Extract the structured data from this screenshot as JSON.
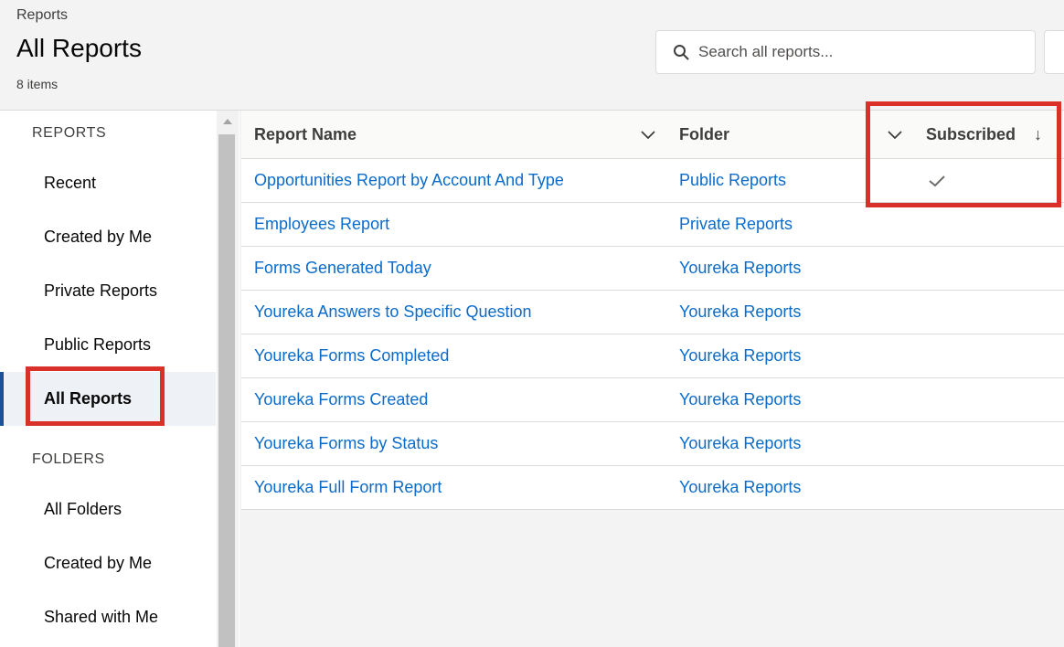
{
  "header": {
    "breadcrumb": "Reports",
    "title": "All Reports",
    "item_count": "8 items",
    "search_placeholder": "Search all reports..."
  },
  "sidebar": {
    "reports_heading": "REPORTS",
    "report_items": [
      {
        "label": "Recent"
      },
      {
        "label": "Created by Me"
      },
      {
        "label": "Private Reports"
      },
      {
        "label": "Public Reports"
      },
      {
        "label": "All Reports",
        "active": true
      }
    ],
    "folders_heading": "FOLDERS",
    "folder_items": [
      {
        "label": "All Folders"
      },
      {
        "label": "Created by Me"
      },
      {
        "label": "Shared with Me"
      }
    ]
  },
  "table": {
    "columns": {
      "report_name": "Report Name",
      "folder": "Folder",
      "subscribed": "Subscribed",
      "sort_indicator": "↓"
    },
    "rows": [
      {
        "name": "Opportunities Report by Account And Type",
        "folder": "Public Reports",
        "subscribed": true
      },
      {
        "name": "Employees Report",
        "folder": "Private Reports",
        "subscribed": false
      },
      {
        "name": "Forms Generated Today",
        "folder": "Youreka Reports",
        "subscribed": false
      },
      {
        "name": "Youreka Answers to Specific Question",
        "folder": "Youreka Reports",
        "subscribed": false
      },
      {
        "name": "Youreka Forms Completed",
        "folder": "Youreka Reports",
        "subscribed": false
      },
      {
        "name": "Youreka Forms Created",
        "folder": "Youreka Reports",
        "subscribed": false
      },
      {
        "name": "Youreka Forms by Status",
        "folder": "Youreka Reports",
        "subscribed": false
      },
      {
        "name": "Youreka Full Form Report",
        "folder": "Youreka Reports",
        "subscribed": false
      }
    ]
  },
  "icons": {
    "search": "search-icon",
    "column_menu": "chevron-down-icon",
    "subscribed": "checkmark-icon"
  },
  "colors": {
    "link": "#0b6bcb",
    "active_indicator": "#1b5297",
    "highlight": "#d9302a"
  }
}
